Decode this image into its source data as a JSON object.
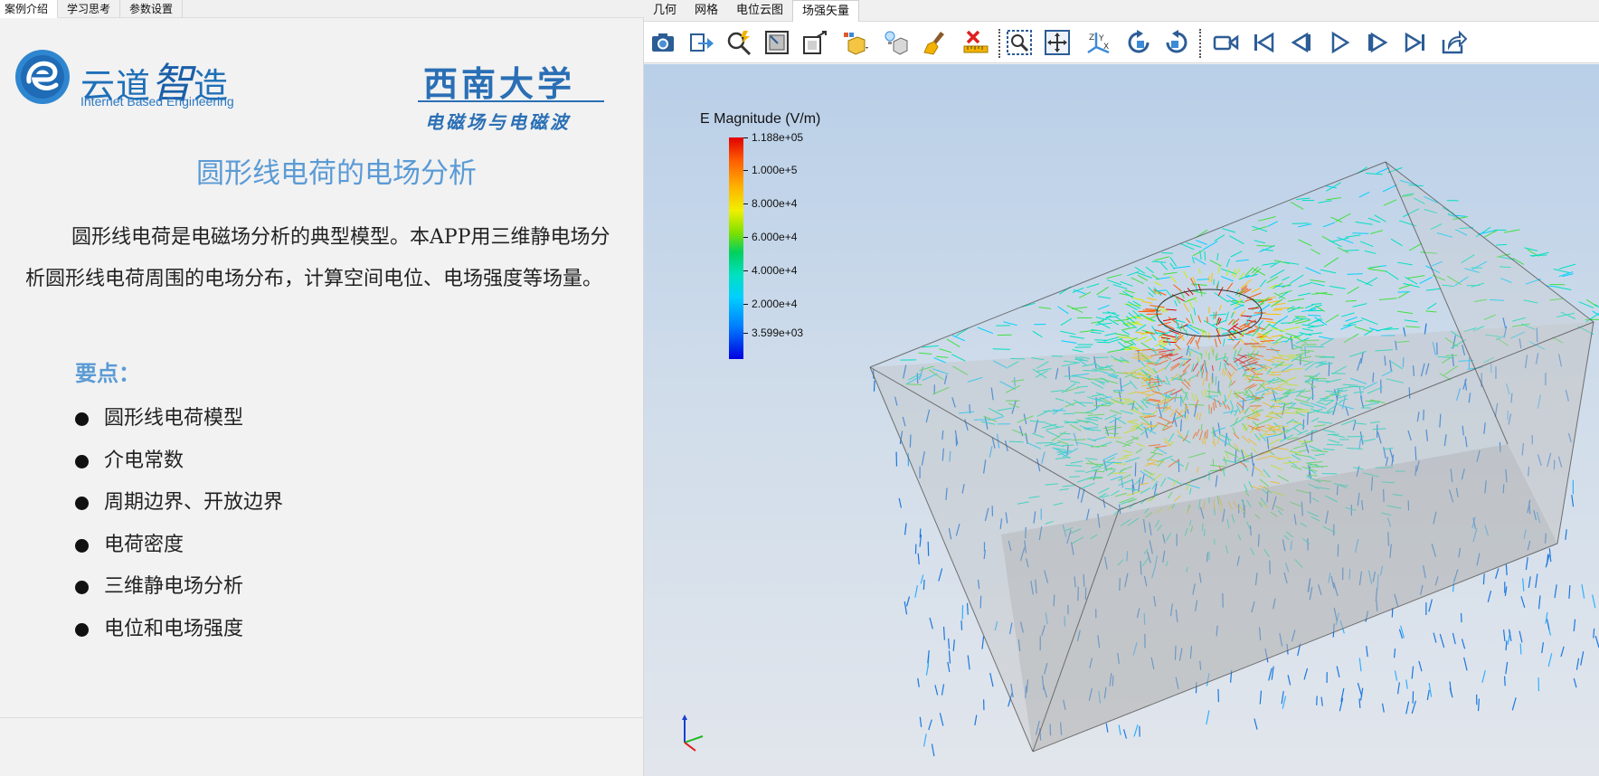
{
  "left_tabs": [
    "案例介绍",
    "学习思考",
    "参数设置"
  ],
  "logo": {
    "brand_cn_a": "云道",
    "brand_cn_b": "智",
    "brand_cn_c": "造",
    "brand_en": "Internet Based Engineering"
  },
  "university": {
    "name": "西南大学",
    "course": "电磁场与电磁波"
  },
  "page_title": "圆形线电荷的电场分析",
  "intro": "圆形线电荷是电磁场分析的典型模型。本APP用三维静电场分析圆形线电荷周围的电场分布，计算空间电位、电场强度等场量。",
  "points_title": "要点：",
  "points": [
    "圆形线电荷模型",
    "介电常数",
    "周期边界、开放边界",
    "电荷密度",
    "三维静电场分析",
    "电位和电场强度"
  ],
  "right_tabs": [
    "几何",
    "网格",
    "电位云图",
    "场强矢量"
  ],
  "active_right_tab": "场强矢量",
  "toolbar_icons": [
    "camera-icon",
    "export-icon",
    "zoom-fit-icon",
    "view-box-icon",
    "view-cube-icon",
    "display-mode-icon",
    "lighting-icon",
    "clean-icon",
    "ruler-delete-icon",
    "zoom-box-icon",
    "pan-icon",
    "axes-orient-icon",
    "rotate-cw-icon",
    "rotate-ccw-icon",
    "record-icon",
    "first-frame-icon",
    "prev-frame-icon",
    "play-icon",
    "next-frame-icon",
    "last-frame-icon",
    "share-icon"
  ],
  "colorbar": {
    "title": "E Magnitude (V/m)",
    "labels": [
      "1.188e+05",
      "1.000e+5",
      "8.000e+4",
      "6.000e+4",
      "4.000e+4",
      "2.000e+4",
      "3.599e+03"
    ]
  },
  "colors": {
    "accent": "#5b9bd5",
    "brand": "#1e6fb7"
  }
}
